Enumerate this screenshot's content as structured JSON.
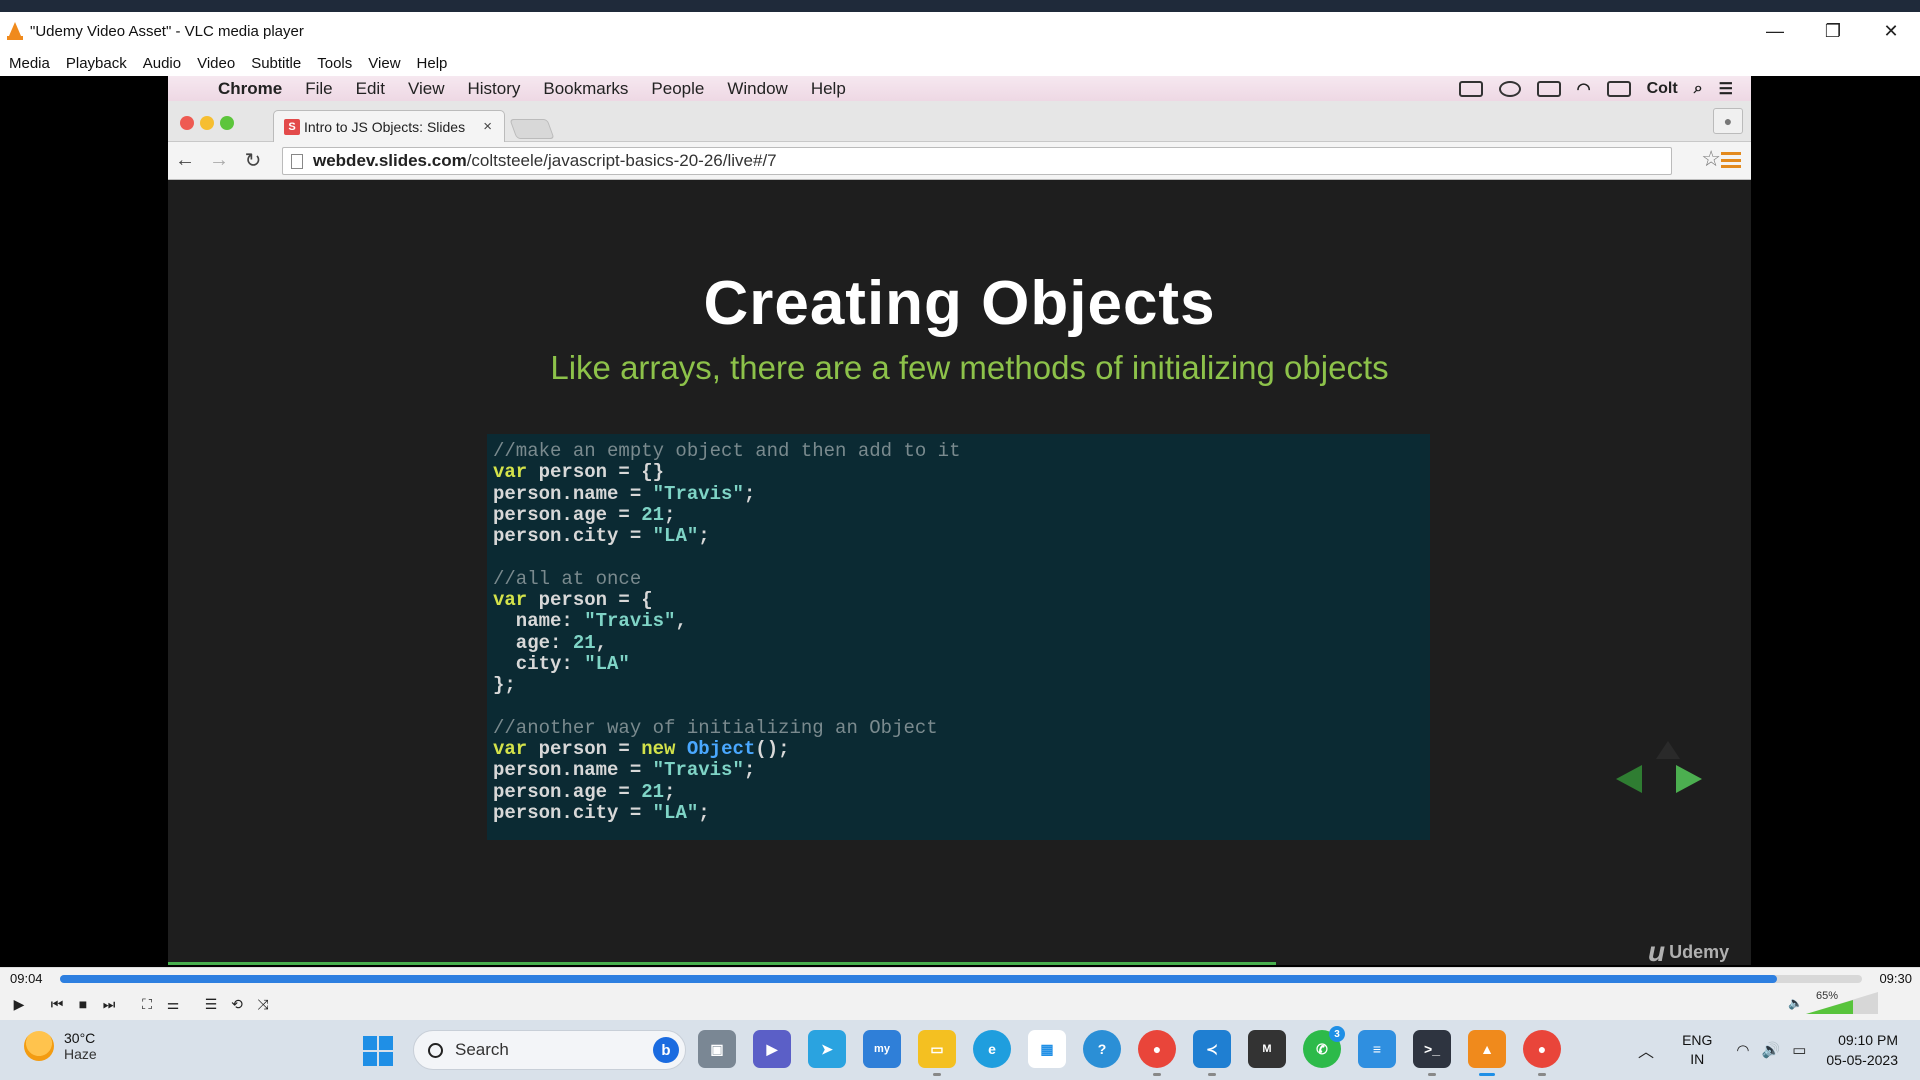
{
  "vlc": {
    "window_title": "\"Udemy Video Asset\" - VLC media player",
    "menu": [
      "Media",
      "Playback",
      "Audio",
      "Video",
      "Subtitle",
      "Tools",
      "View",
      "Help"
    ],
    "window_controls": {
      "minimize": "—",
      "restore": "❐",
      "close": "✕"
    }
  },
  "mac": {
    "menubar": {
      "apple_glyph": "",
      "items": [
        "Chrome",
        "File",
        "Edit",
        "View",
        "History",
        "Bookmarks",
        "People",
        "Window",
        "Help"
      ],
      "status_user": "Colt"
    },
    "chrome": {
      "tab_title": "Intro to JS Objects: Slides",
      "tab_favicon": "S",
      "tab_close": "×",
      "url_host": "webdev.slides.com",
      "url_path": "/coltsteele/javascript-basics-20-26/live#/7",
      "back": "←",
      "forward": "→",
      "reload": "↻",
      "star": "☆"
    },
    "slide": {
      "title": "Creating Objects",
      "subtitle": "Like arrays, there are a few methods of initializing objects",
      "watermark": "Udemy",
      "watermark_glyph": "u",
      "progress": 0.7
    }
  },
  "playback": {
    "current_time": "09:04",
    "total_time": "09:30",
    "progress": 0.953,
    "volume_label": "65%",
    "volume": 0.65
  },
  "taskbar": {
    "temperature": "30°C",
    "weather": "Haze",
    "search_placeholder": "Search",
    "bing_glyph": "b",
    "whatsapp_badge": "3",
    "lang_line1": "ENG",
    "lang_line2": "IN",
    "time": "09:10 PM",
    "date": "05-05-2023"
  },
  "colors": {
    "accent_blue": "#2d7fe0",
    "slide_green": "#8dc24a",
    "code_bg": "#0b2a33",
    "code_keyword": "#d3e24a",
    "code_string": "#7fd4c6"
  }
}
